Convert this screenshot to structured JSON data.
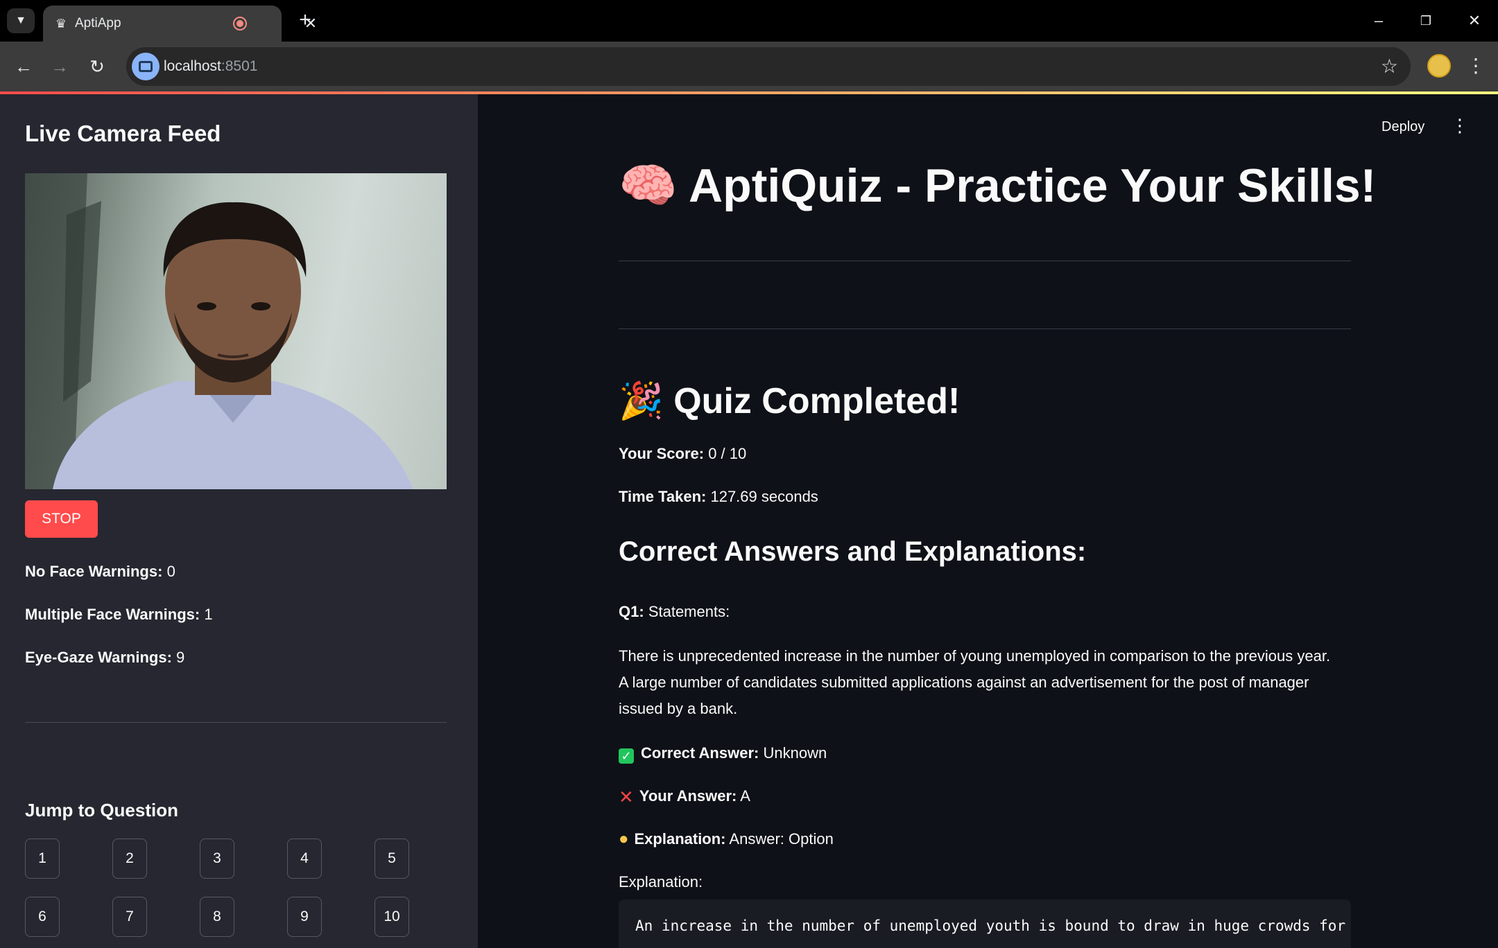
{
  "browser": {
    "tab_title": "AptiApp",
    "url_host": "localhost",
    "url_port": ":8501"
  },
  "app": {
    "deploy_label": "Deploy",
    "colors": {
      "accent": "#ff4b4b",
      "background": "#0e1117",
      "sidebar": "#262730"
    }
  },
  "sidebar": {
    "title": "Live Camera Feed",
    "stop_label": "STOP",
    "warnings": [
      {
        "label": "No Face Warnings:",
        "value": "0"
      },
      {
        "label": "Multiple Face Warnings:",
        "value": "1"
      },
      {
        "label": "Eye-Gaze Warnings:",
        "value": "9"
      }
    ],
    "jump_title": "Jump to Question",
    "question_buttons": [
      "1",
      "2",
      "3",
      "4",
      "5",
      "6",
      "7",
      "8",
      "9",
      "10"
    ]
  },
  "main": {
    "title_emoji": "🧠",
    "title": "AptiQuiz - Practice Your Skills!",
    "completed_emoji": "🎉",
    "completed": "Quiz Completed!",
    "score_label": "Your Score:",
    "score_value": "0 / 10",
    "time_label": "Time Taken:",
    "time_value": "127.69 seconds",
    "answers_heading": "Correct Answers and Explanations:",
    "q1_label": "Q1:",
    "q1_text": "Statements:",
    "statement_lines": [
      "There is unprecedented increase in the number of young unemployed in comparison to the previous year.",
      "A large number of candidates submitted applications against an advertisement for the post of manager",
      "issued by a bank."
    ],
    "correct_label": "Correct Answer:",
    "correct_value": "Unknown",
    "your_label": "Your Answer:",
    "your_value": "A",
    "explanation_label": "Explanation:",
    "explanation_value": "Answer: Option",
    "explanation_heading": "Explanation:",
    "code_text": "An increase in the number of unemployed youth is bound to draw in huge crowds for"
  }
}
